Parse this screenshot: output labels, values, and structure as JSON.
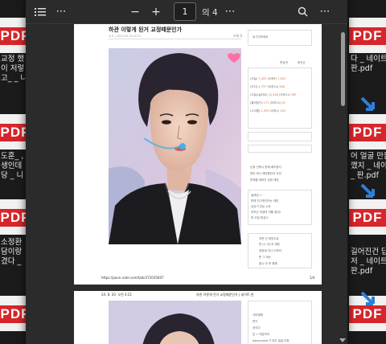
{
  "desktop": {
    "pdf_badge": "PDF",
    "left_captions": [
      [
        "교정 했",
        "이 저렇",
        "고_ _ 니"
      ],
      [
        "도훈_ ,",
        "생인데",
        "당 _ 니"
      ],
      [
        "소정환",
        "담이랑",
        "겼다 _ "
      ]
    ],
    "right_captions": [
      [
        "다 _ 네이트",
        "판.pdf"
      ],
      [
        "어 얼굴 만들",
        "깼지 _ 네이",
        "_ 판.pdf"
      ],
      [
        "길어진건 답",
        "저 _ 네이트",
        "판.pdf"
      ]
    ]
  },
  "viewer": {
    "toolbar": {
      "zoom_out": "−",
      "zoom_in": "+",
      "current_page": "1",
      "of_pages": "의 4"
    },
    "page1": {
      "title": "하관 이렇게 된거 교정때문인가",
      "meta": "ㅎㅎ | 2024.05.20 00:11",
      "meta_right": "조회 0",
      "footer_url": "https://pann.nate.com/talk/372035607",
      "footer_page": "1/4",
      "side": {
        "label_login": "로그인하세요",
        "label_search": "판검색",
        "label_sort": "최신순",
        "stats": [
          [
            "(오늘)",
            "7,405",
            "(오후9)",
            "7,405"
          ],
          [
            "(지식)",
            "4,737",
            "(오후10)",
            "548"
          ],
          [
            "(오늘)(싫어요)",
            "12,446",
            "(오후11)",
            "765"
          ],
          [
            "(즐겨찾기)",
            "172",
            "(오후12)",
            "63"
          ],
          [
            "(스크랩)",
            "1,090",
            "(오후1)",
            "104"
          ]
        ],
        "links": [
          [
            "순위",
            "선택시 판에 베이한다"
          ],
          [
            "판타",
            "하나 재밌했던지 우리"
          ],
          [
            "판채움",
            "재버인 당한 재밌"
          ]
        ],
        "topics": [
          "설레임 +",
          "판에 전고퀴이러는 재밌",
          "성공기 전능 누요",
          "따조는 하생의 끼를 업데!",
          "판 오일 휴성시"
        ],
        "list": [
          "되판 진 재밌으로",
          "판 너 그는지 재밌",
          "광동생 어나 더보라",
          "판 그 하는",
          "몇시 아 보 몇해"
        ]
      }
    },
    "page2": {
      "header_left": "24. 8. 20. 오전 4:21",
      "header_center": "하관 이렇게 된거 교정때문인가 | 네이트 판",
      "side_items": [
        "사따명예",
        "판이",
        "공이다",
        "앉 + 매맞어지",
        "babycomer가 아무 얼굴 다형"
      ]
    }
  }
}
